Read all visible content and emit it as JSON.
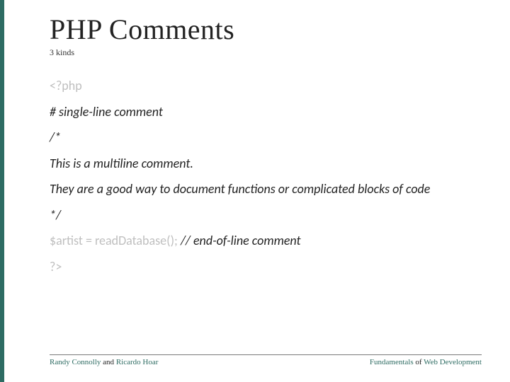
{
  "title": "PHP Comments",
  "subtitle": "3 kinds",
  "code": {
    "open_tag": "<?php",
    "hash_comment": "# single-line comment",
    "block_open": "/*",
    "multiline1": "This is a multiline comment.",
    "multiline2": "They are a good way to document functions or complicated blocks of code",
    "block_close": "*/",
    "stmt_prefix": "$artist = readDatabase(); ",
    "eol_comment": "// end-of-line comment",
    "close_tag": "?>"
  },
  "footer": {
    "left_name1": "Randy Connolly",
    "left_join": " and ",
    "left_name2": "Ricardo Hoar",
    "right_word1": "Fundamentals",
    "right_join": " of ",
    "right_word2": "Web Development"
  }
}
